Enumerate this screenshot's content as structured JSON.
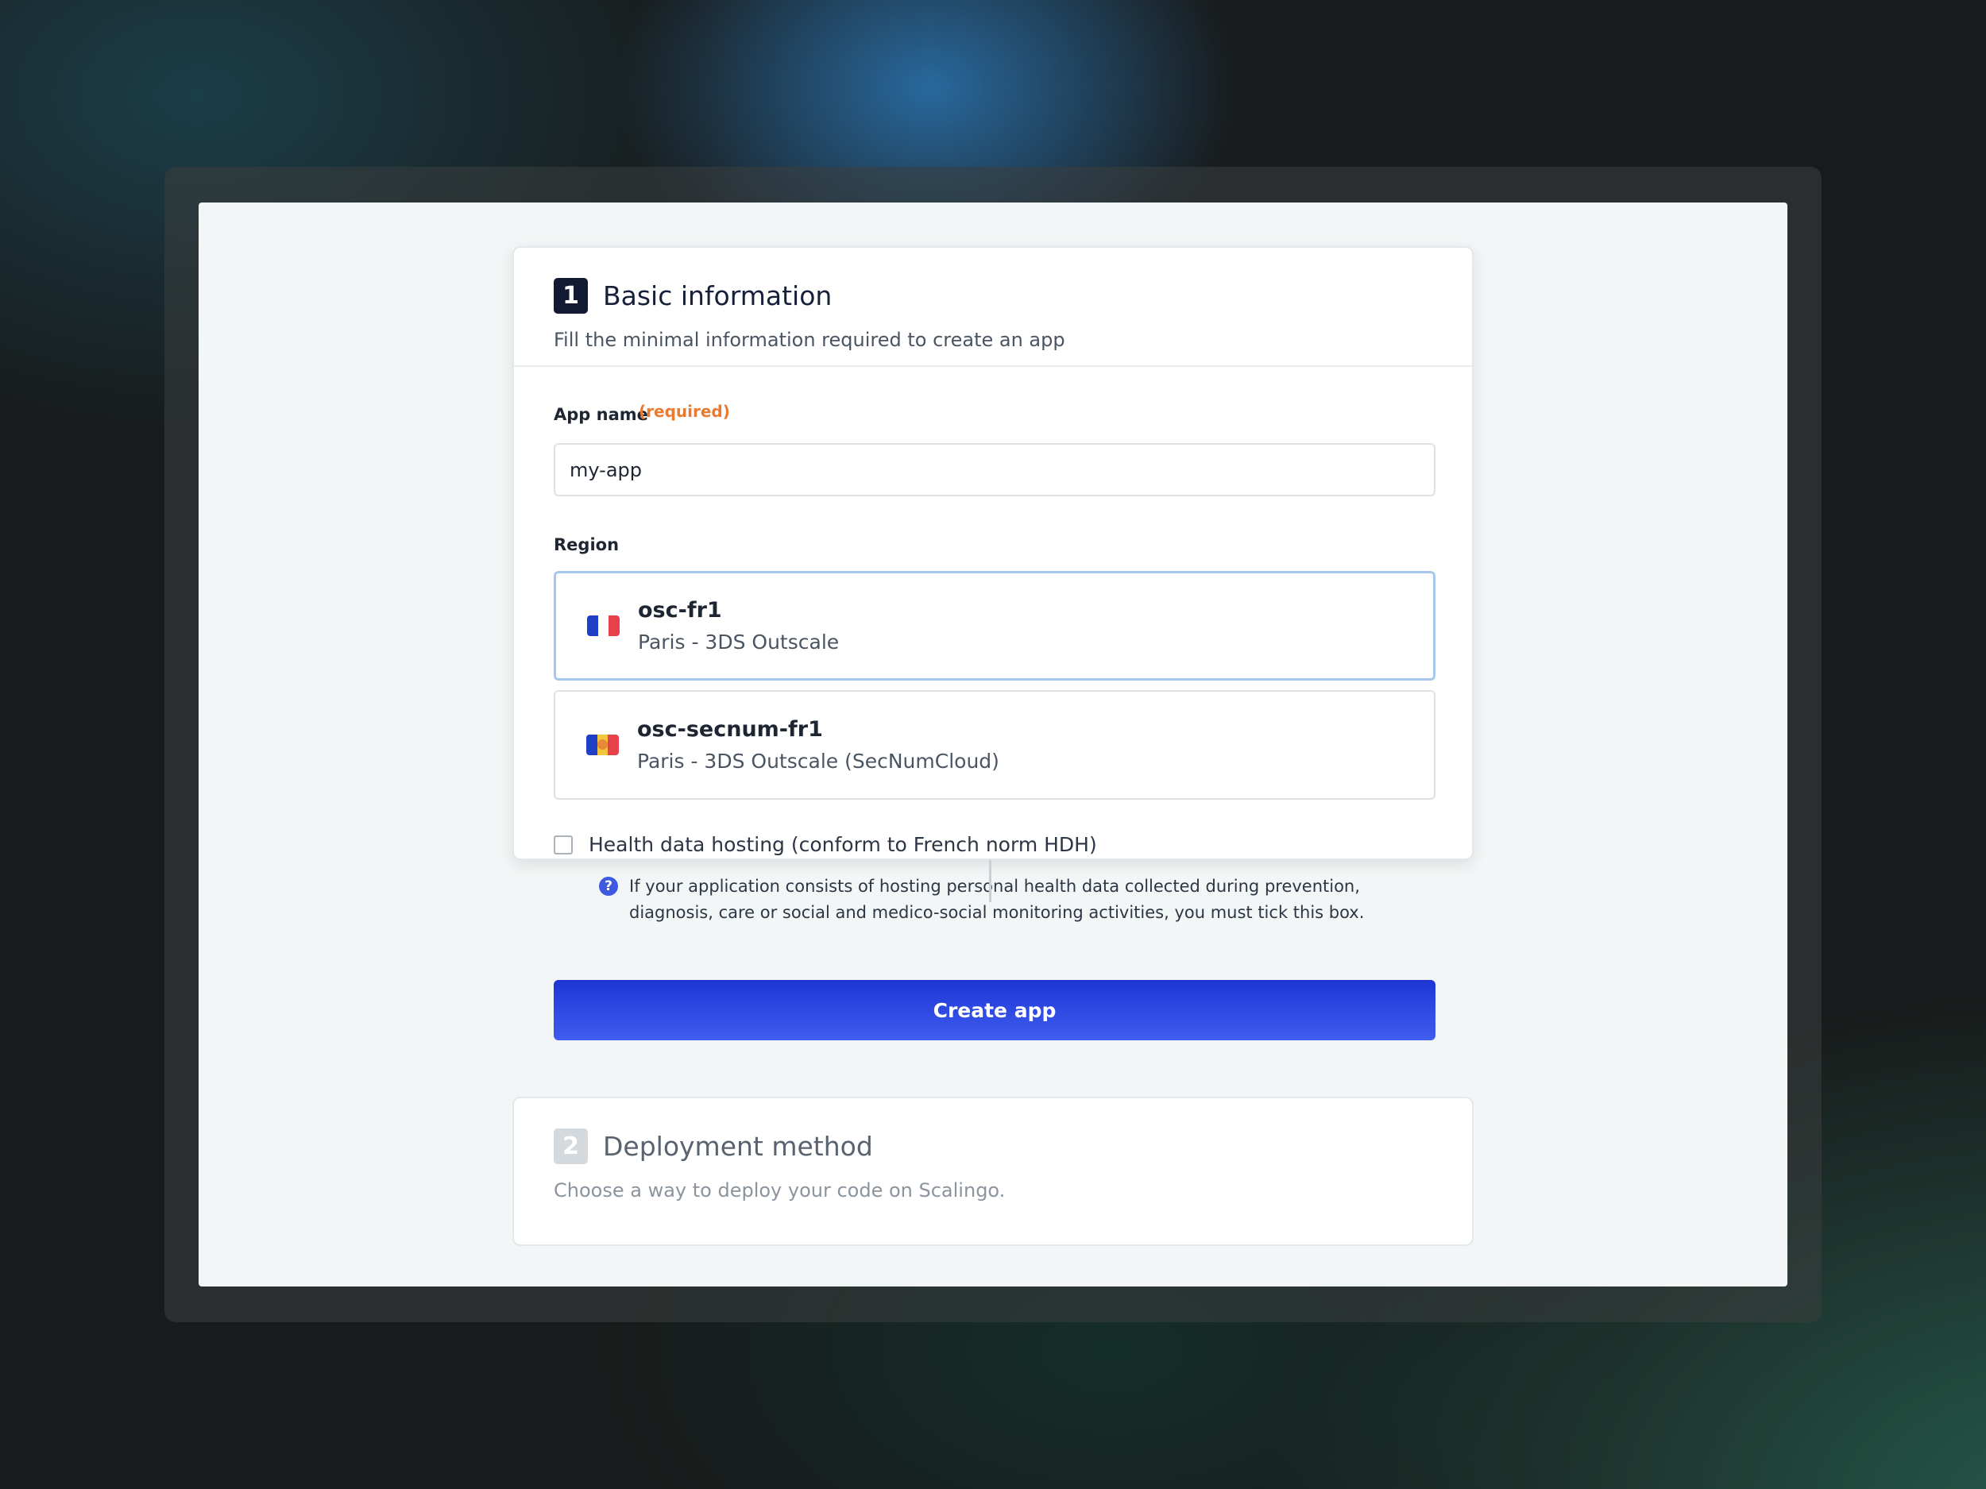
{
  "step1": {
    "number": "1",
    "title": "Basic information",
    "subtitle": "Fill the minimal information required to create an app"
  },
  "app_name": {
    "label": "App name",
    "required_tag": "(required)",
    "value": "my-app"
  },
  "region": {
    "label": "Region",
    "options": [
      {
        "code": "osc-fr1",
        "description": "Paris - 3DS Outscale",
        "flag_icon": "france-flag-icon",
        "selected": true
      },
      {
        "code": "osc-secnum-fr1",
        "description": "Paris - 3DS Outscale (SecNumCloud)",
        "flag_icon": "secnumcloud-flag-icon",
        "selected": false
      }
    ]
  },
  "hdh": {
    "checkbox_label": "Health data hosting (conform to French norm HDH)",
    "checked": false,
    "info_icon": "question-icon",
    "info_text": "If your application consists of hosting personal health data collected during prevention, diagnosis, care or social and medico-social monitoring activities, you must tick this box."
  },
  "create_button_label": "Create app",
  "step2": {
    "number": "2",
    "title": "Deployment method",
    "subtitle": "Choose a way to deploy your code on Scalingo."
  },
  "colors": {
    "accent": "#2a45e3",
    "required": "#e97a30",
    "step_active": "#121a33",
    "selected_border": "#a6c8ee"
  }
}
